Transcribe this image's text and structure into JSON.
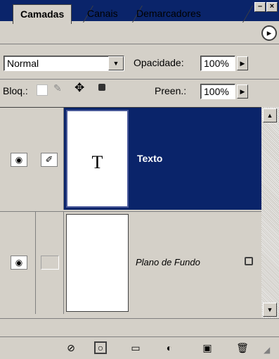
{
  "tabs": [
    {
      "label": "Camadas"
    },
    {
      "label": "Canais"
    },
    {
      "label": "Demarcadores"
    }
  ],
  "blend_mode": {
    "value": "Normal"
  },
  "opacity": {
    "label": "Opacidade:",
    "value": "100%"
  },
  "lock": {
    "label": "Bloq.:"
  },
  "fill": {
    "label": "Preen.:",
    "value": "100%"
  },
  "layers": [
    {
      "name": "Texto",
      "thumb_text": "T",
      "selected": true
    },
    {
      "name": "Plano de Fundo",
      "selected": false
    }
  ],
  "colors": {
    "selection": "#0a246a",
    "panel": "#d4d0c8"
  },
  "icons": [
    "eye-icon",
    "brush-icon",
    "lock-icon",
    "layer-style-icon",
    "mask-icon",
    "folder-icon",
    "adjustment-icon",
    "new-layer-icon",
    "trash-icon"
  ]
}
